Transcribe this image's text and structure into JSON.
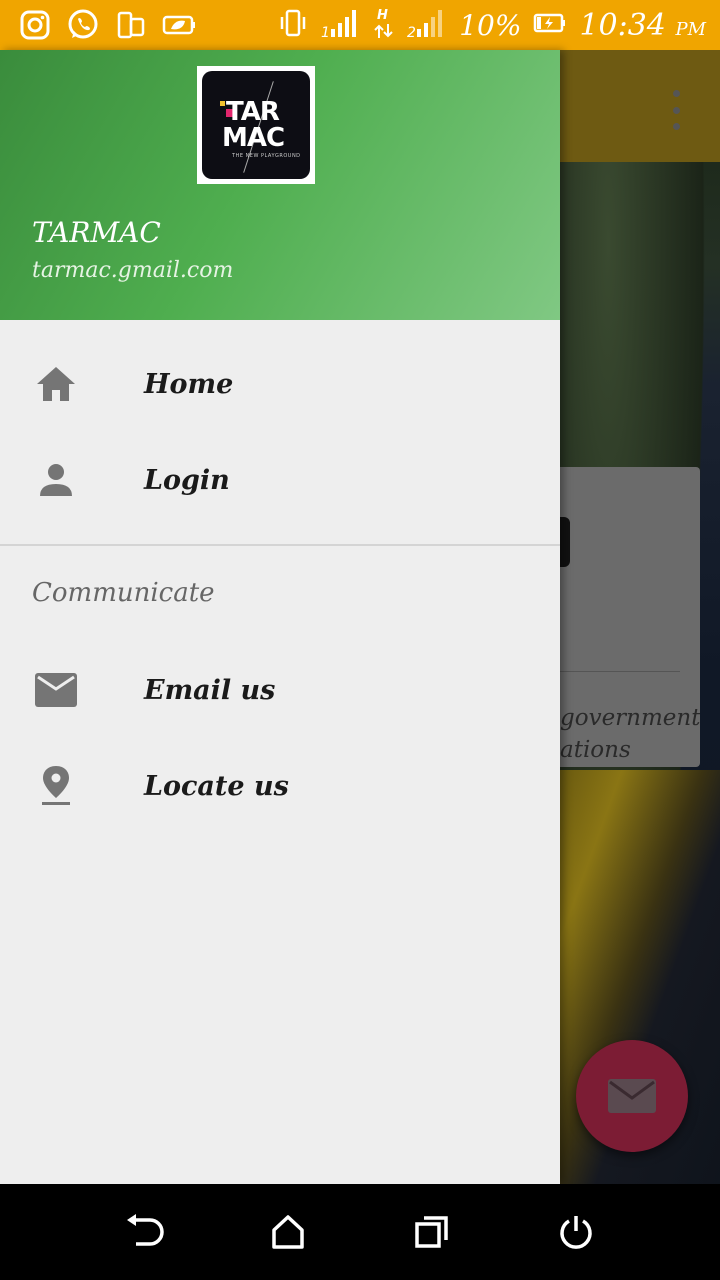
{
  "status_bar": {
    "battery_percent": "10%",
    "time": "10:34",
    "time_suffix": "PM",
    "left_icons": [
      "instagram-icon",
      "whatsapp-icon",
      "phone-clone-icon",
      "battery-saver-icon"
    ],
    "right_icons": [
      "vibrate-icon",
      "signal-1-icon",
      "data-h-icon",
      "signal-2-icon",
      "battery-charging-icon"
    ]
  },
  "drawer": {
    "header": {
      "logo_line1": "TAR",
      "logo_line2": "MAC",
      "logo_tagline": "THE NEW PLAYGROUND",
      "user_name": "TARMAC",
      "user_email": "tarmac.gmail.com"
    },
    "items": [
      {
        "label": "Home",
        "icon": "home-icon"
      },
      {
        "label": "Login",
        "icon": "person-icon"
      }
    ],
    "section_title": "Communicate",
    "communicate_items": [
      {
        "label": "Email us",
        "icon": "email-icon"
      },
      {
        "label": "Locate us",
        "icon": "location-pin-icon"
      }
    ]
  },
  "background": {
    "card_text_line1": "government",
    "card_text_line2": "ations"
  },
  "nav_bar": {
    "buttons": [
      "back-icon",
      "home-icon",
      "recents-icon",
      "power-icon"
    ]
  },
  "colors": {
    "status_bar": "#f0a500",
    "header_start": "#3a8c3c",
    "header_end": "#80c883",
    "drawer_bg": "#eeeeee",
    "fab": "#7c1c34"
  }
}
